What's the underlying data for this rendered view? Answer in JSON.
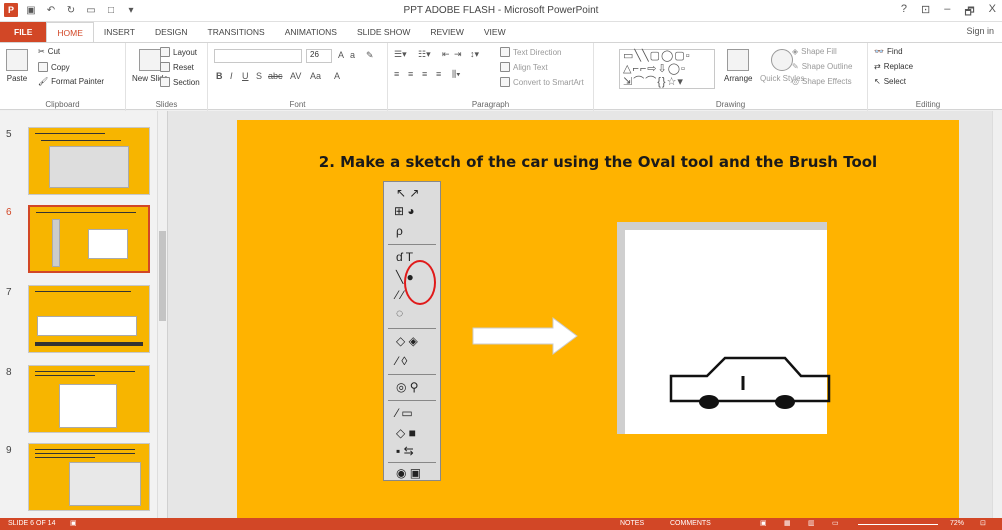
{
  "window": {
    "title": "PPT ADOBE FLASH - Microsoft PowerPoint",
    "help": "?",
    "minimize": "–",
    "restore": "🗗",
    "close": "X"
  },
  "tabs": [
    "FILE",
    "HOME",
    "INSERT",
    "DESIGN",
    "TRANSITIONS",
    "ANIMATIONS",
    "SLIDE SHOW",
    "REVIEW",
    "VIEW"
  ],
  "active_tab": "HOME",
  "signin": "Sign in",
  "ribbon": {
    "clipboard": {
      "label": "Clipboard",
      "paste": "Paste",
      "cut": "Cut",
      "copy": "Copy",
      "format_painter": "Format Painter"
    },
    "slides": {
      "label": "Slides",
      "new_slide": "New Slide",
      "layout": "Layout",
      "reset": "Reset",
      "section": "Section"
    },
    "font": {
      "label": "Font",
      "size": "26"
    },
    "paragraph": {
      "label": "Paragraph",
      "text_direction": "Text Direction",
      "align_text": "Align Text",
      "convert_smartart": "Convert to SmartArt"
    },
    "drawing": {
      "label": "Drawing",
      "arrange": "Arrange",
      "quick_styles": "Quick Styles",
      "shape_fill": "Shape Fill",
      "shape_outline": "Shape Outline",
      "shape_effects": "Shape Effects"
    },
    "editing": {
      "label": "Editing",
      "find": "Find",
      "replace": "Replace",
      "select": "Select"
    }
  },
  "thumbnails": [
    {
      "num": "5"
    },
    {
      "num": "6",
      "selected": true
    },
    {
      "num": "7"
    },
    {
      "num": "8"
    },
    {
      "num": "9"
    }
  ],
  "slide": {
    "heading": "2. Make a sketch of the car using the Oval tool and the Brush Tool"
  },
  "status": {
    "slide_info": "SLIDE 6 OF 14",
    "notes": "NOTES",
    "comments": "COMMENTS",
    "zoom": "72%"
  }
}
